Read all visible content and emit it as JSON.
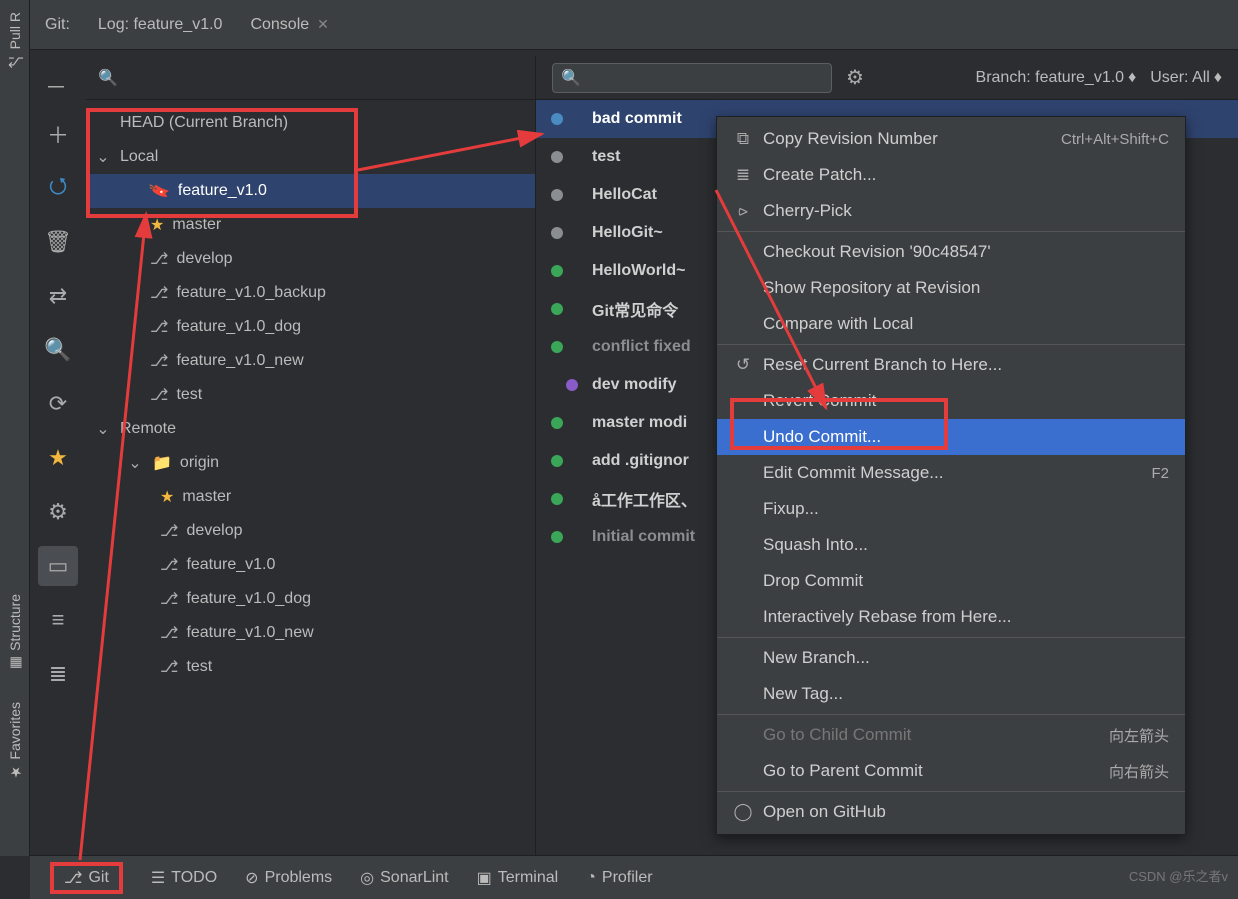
{
  "topTabs": {
    "git": "Git:",
    "log": "Log: feature_v1.0",
    "console": "Console"
  },
  "leftBar": {
    "pull": "Pull R",
    "structure": "Structure",
    "favorites": "Favorites"
  },
  "branchHeader": "HEAD (Current Branch)",
  "branches": {
    "localLabel": "Local",
    "local": [
      {
        "name": "feature_v1.0",
        "icon": "tag",
        "selected": true
      },
      {
        "name": "master",
        "icon": "star"
      },
      {
        "name": "develop",
        "icon": "branch"
      },
      {
        "name": "feature_v1.0_backup",
        "icon": "branch"
      },
      {
        "name": "feature_v1.0_dog",
        "icon": "branch"
      },
      {
        "name": "feature_v1.0_new",
        "icon": "branch"
      },
      {
        "name": "test",
        "icon": "branch"
      }
    ],
    "remoteLabel": "Remote",
    "origin": "origin",
    "remote": [
      {
        "name": "master",
        "icon": "star"
      },
      {
        "name": "develop",
        "icon": "branch"
      },
      {
        "name": "feature_v1.0",
        "icon": "branch"
      },
      {
        "name": "feature_v1.0_dog",
        "icon": "branch"
      },
      {
        "name": "feature_v1.0_new",
        "icon": "branch"
      },
      {
        "name": "test",
        "icon": "branch"
      }
    ]
  },
  "filters": {
    "branch": "Branch: feature_v1.0",
    "user": "User: All"
  },
  "commits": [
    {
      "msg": "bad commit",
      "dot": "blue",
      "sel": true,
      "pos": 0
    },
    {
      "msg": "test",
      "dot": "gray",
      "pos": 0
    },
    {
      "msg": "HelloCat",
      "dot": "gray",
      "pos": 0
    },
    {
      "msg": "HelloGit~",
      "dot": "gray",
      "pos": 0
    },
    {
      "msg": "HelloWorld~",
      "dot": "green",
      "pos": 0
    },
    {
      "msg": "Git常见命令",
      "dot": "green",
      "pos": 0
    },
    {
      "msg": "conflict fixed",
      "dot": "green",
      "gray": true,
      "pos": 0
    },
    {
      "msg": "dev modify",
      "dot": "purple",
      "pos": 1
    },
    {
      "msg": "master modi",
      "dot": "green",
      "pos": 0
    },
    {
      "msg": "add .gitignor",
      "dot": "green",
      "pos": 0
    },
    {
      "msg": "å工作工作区、",
      "dot": "green",
      "pos": 0
    },
    {
      "msg": "Initial commit",
      "dot": "green",
      "gray": true,
      "pos": 0
    }
  ],
  "ctx": {
    "copy": "Copy Revision Number",
    "copy_sc": "Ctrl+Alt+Shift+C",
    "patch": "Create Patch...",
    "cherry": "Cherry-Pick",
    "checkout": "Checkout Revision '90c48547'",
    "show": "Show Repository at Revision",
    "compare": "Compare with Local",
    "reset": "Reset Current Branch to Here...",
    "revert": "Revert Commit",
    "undo": "Undo Commit...",
    "edit": "Edit Commit Message...",
    "edit_sc": "F2",
    "fixup": "Fixup...",
    "squash": "Squash Into...",
    "drop": "Drop Commit",
    "rebase": "Interactively Rebase from Here...",
    "newbranch": "New Branch...",
    "newtag": "New Tag...",
    "child": "Go to Child Commit",
    "child_sc": "向左箭头",
    "parent": "Go to Parent Commit",
    "parent_sc": "向右箭头",
    "github": "Open on GitHub"
  },
  "bottom": {
    "git": "Git",
    "todo": "TODO",
    "problems": "Problems",
    "sonar": "SonarLint",
    "terminal": "Terminal",
    "profiler": "Profiler"
  },
  "watermark": "CSDN @乐之者v"
}
